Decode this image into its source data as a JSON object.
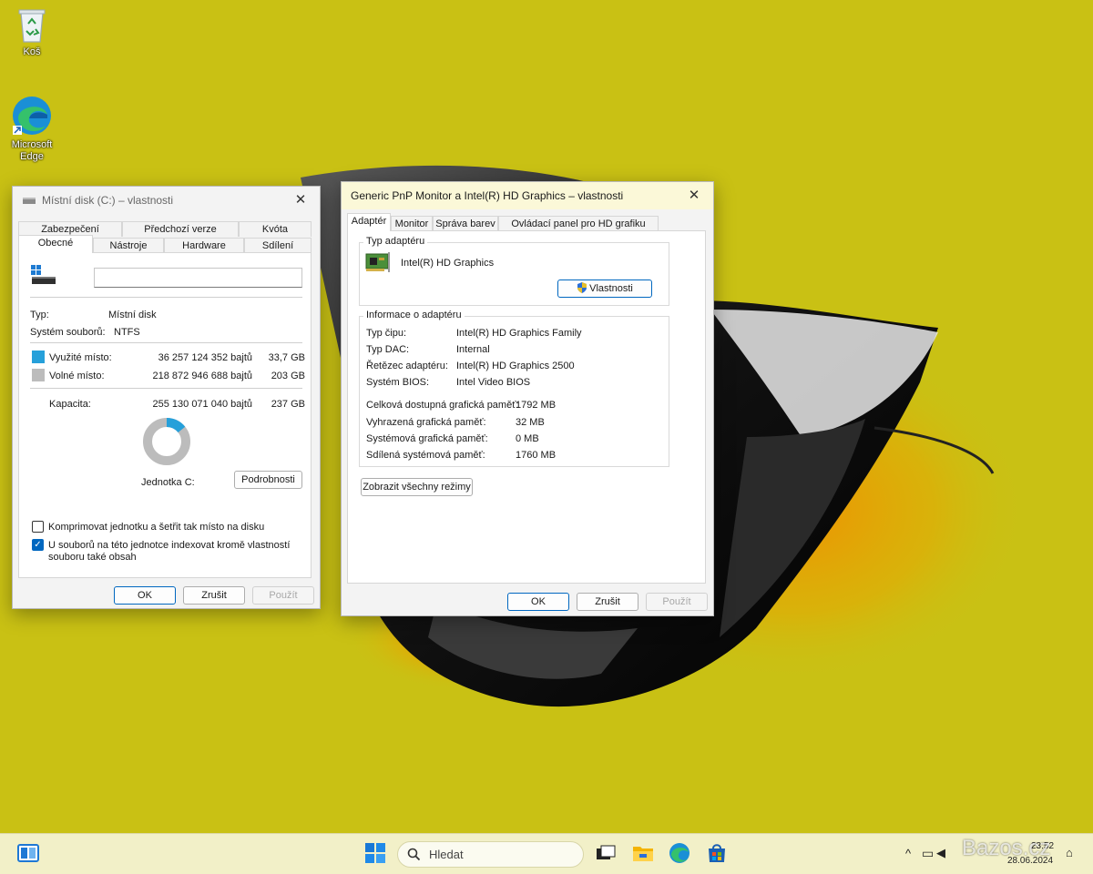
{
  "desktop": {
    "icons": [
      {
        "label": "Koš",
        "icon": "recycle-bin-icon"
      },
      {
        "label": "Microsoft Edge",
        "icon": "edge-icon"
      }
    ]
  },
  "disk_window": {
    "title": "Místní disk (C:) – vlastnosti",
    "tabs_row1": [
      "Zabezpečení",
      "Předchozí verze",
      "Kvóta"
    ],
    "tabs_row2": [
      "Obecné",
      "Nástroje",
      "Hardware",
      "Sdílení"
    ],
    "active_tab": "Obecné",
    "name_value": "",
    "type_label": "Typ:",
    "type_value": "Místní disk",
    "fs_label": "Systém souborů:",
    "fs_value": "NTFS",
    "used_label": "Využité místo:",
    "used_bytes": "36 257 124 352 bajtů",
    "used_gb": "33,7 GB",
    "free_label": "Volné místo:",
    "free_bytes": "218 872 946 688 bajtů",
    "free_gb": "203 GB",
    "capacity_label": "Kapacita:",
    "capacity_bytes": "255 130 071 040 bajtů",
    "capacity_gb": "237 GB",
    "used_fraction": 0.142,
    "used_color": "#26a0da",
    "free_color": "#bcbcbc",
    "drive_label": "Jednotka C:",
    "details_button": "Podrobnosti",
    "compress_label": "Komprimovat jednotku a šetřit tak místo na disku",
    "compress_checked": false,
    "index_label_1": "U souborů na této jednotce indexovat kromě vlastností",
    "index_label_2": "souboru také obsah",
    "index_checked": true,
    "ok": "OK",
    "cancel": "Zrušit",
    "apply": "Použít"
  },
  "monitor_window": {
    "title": "Generic PnP Monitor a Intel(R) HD Graphics – vlastnosti",
    "tabs": [
      "Adaptér",
      "Monitor",
      "Správa barev",
      "Ovládací panel pro HD grafiku Intel®"
    ],
    "active_tab": "Adaptér",
    "adapter_group": "Typ adaptéru",
    "adapter_name": "Intel(R) HD Graphics",
    "properties_button": "Vlastnosti",
    "info_group": "Informace o adaptéru",
    "info_rows": [
      {
        "label": "Typ čipu:",
        "value": "Intel(R) HD Graphics Family"
      },
      {
        "label": "Typ DAC:",
        "value": "Internal"
      },
      {
        "label": "Řetězec adaptéru:",
        "value": "Intel(R) HD Graphics 2500"
      },
      {
        "label": "Systém BIOS:",
        "value": "Intel Video BIOS"
      }
    ],
    "memory_rows": [
      {
        "label": "Celková dostupná grafická paměť:",
        "value": "1792 MB"
      },
      {
        "label": "Vyhrazená grafická paměť:",
        "value": "32 MB"
      },
      {
        "label": "Systémová grafická paměť:",
        "value": "0 MB"
      },
      {
        "label": "Sdílená systémová paměť:",
        "value": "1760 MB"
      }
    ],
    "list_modes_button": "Zobrazit všechny režimy",
    "ok": "OK",
    "cancel": "Zrušit",
    "apply": "Použít"
  },
  "taskbar": {
    "search_placeholder": "Hledat",
    "clock_time": "23:52",
    "clock_date": "28.06.2024",
    "watermark": "Bazos.cz"
  }
}
